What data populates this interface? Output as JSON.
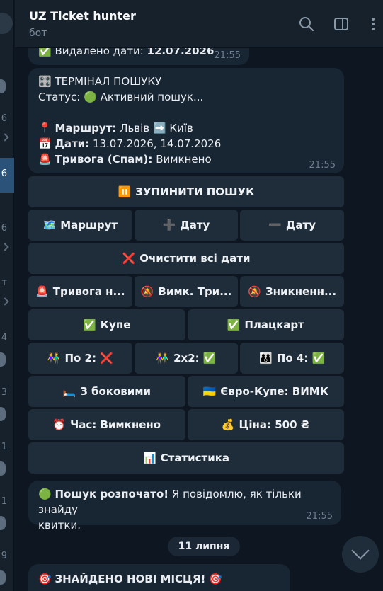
{
  "header": {
    "title": "UZ Ticket hunter",
    "subtitle": "бот"
  },
  "chatlist": {
    "counts": [
      "6",
      "6",
      "6",
      "т",
      "4",
      "3",
      "1",
      "1",
      "9"
    ]
  },
  "messages": {
    "deleted": {
      "emoji": "✅",
      "label": "Видалено дати:",
      "value": "12.07.2026",
      "time": "21:55"
    },
    "terminal": {
      "title_emoji": "🎛️",
      "title": "ТЕРМІНАЛ ПОШУКУ",
      "status_label": "Статус:",
      "status_emoji": "🟢",
      "status_value": "Активний пошук...",
      "route_emoji": "📍",
      "route_label": "Маршрут:",
      "route_from": "Львів",
      "route_arrow": "➡️",
      "route_to": "Київ",
      "dates_emoji": "📅",
      "dates_label": "Дати:",
      "dates_value": "13.07.2026, 14.07.2026",
      "alarm_emoji": "🚨",
      "alarm_label": "Тривога (Спам):",
      "alarm_value": "Вимкнено",
      "time": "21:55"
    },
    "started": {
      "emoji": "🟢",
      "bold": "Пошук розпочато!",
      "text1": "Я повідомлю, як тільки знайду",
      "text2": "квитки.",
      "time": "21:55"
    },
    "date_separator": "11 липня",
    "found": {
      "emoji": "🎯",
      "text": "ЗНАЙДЕНО НОВІ МІСЦЯ!"
    }
  },
  "keyboard": {
    "stop": {
      "emoji": "⏸️",
      "label": "ЗУПИНИТИ ПОШУК"
    },
    "route": {
      "emoji": "🗺️",
      "label": "Маршрут"
    },
    "add_date": {
      "emoji": "➕",
      "label": "Дату"
    },
    "remove_date": {
      "emoji": "➖",
      "label": "Дату"
    },
    "clear_dates": {
      "emoji": "❌",
      "label": "Очистити всі дати"
    },
    "alarm": {
      "emoji": "🚨",
      "label": "Тривога н..."
    },
    "mute_alarm": {
      "emoji": "🔕",
      "label": "Вимк. Три..."
    },
    "disappear": {
      "emoji": "🔕",
      "label": "Зникненн..."
    },
    "kupe": {
      "emoji": "✅",
      "label": "Купе"
    },
    "platskart": {
      "emoji": "✅",
      "label": "Плацкарт"
    },
    "by2": {
      "emoji": "👫",
      "label": "По 2:",
      "state": "❌"
    },
    "x2x2": {
      "emoji": "👫",
      "label": "2x2:",
      "state": "✅"
    },
    "by4": {
      "emoji": "👪",
      "label": "По 4:",
      "state": "✅"
    },
    "side": {
      "emoji": "🛏️",
      "label": "З боковими"
    },
    "euro": {
      "emoji": "🇺🇦",
      "label": "Євро-Купе: ВИМК"
    },
    "time": {
      "emoji": "⏰",
      "label": "Час: Вимкнено"
    },
    "price": {
      "emoji": "💰",
      "label": "Ціна: 500 ₴"
    },
    "stats": {
      "emoji": "📊",
      "label": "Статистика"
    }
  },
  "colors": {
    "background": "#0e1621",
    "bubble": "#182533",
    "button": "#1f2d3b",
    "header": "#17212b"
  }
}
